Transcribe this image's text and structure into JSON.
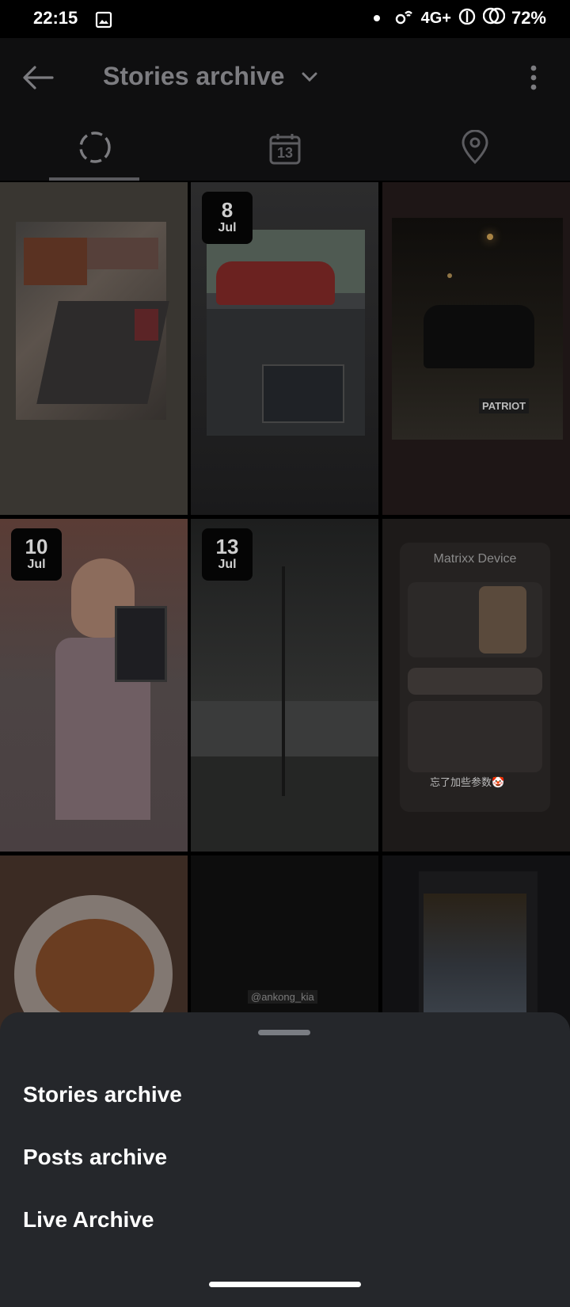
{
  "status_bar": {
    "time": "22:15",
    "network": "4G+",
    "battery": "72%"
  },
  "header": {
    "title": "Stories archive"
  },
  "tabs": [
    {
      "name": "stories",
      "icon": "circle-dashed-icon",
      "active": true
    },
    {
      "name": "calendar",
      "icon": "calendar-icon",
      "calendar_day": "13"
    },
    {
      "name": "map",
      "icon": "location-pin-icon"
    }
  ],
  "grid": {
    "tiles": [
      {
        "id": "hotpot",
        "badge": null
      },
      {
        "id": "car",
        "badge": {
          "day": "8",
          "month": "Jul"
        }
      },
      {
        "id": "night-car",
        "badge": null,
        "caption": "PATRIOT"
      },
      {
        "id": "person",
        "badge": {
          "day": "10",
          "month": "Jul"
        }
      },
      {
        "id": "hall",
        "badge": {
          "day": "13",
          "month": "Jul"
        }
      },
      {
        "id": "matrixx",
        "badge": null,
        "title": "Matrixx Device",
        "caption": "忘了加些参数🤡"
      },
      {
        "id": "noodles",
        "badge": null
      },
      {
        "id": "dark",
        "badge": null,
        "caption": "@ankong_kia"
      },
      {
        "id": "screenshot",
        "badge": null
      }
    ]
  },
  "sheet": {
    "items": [
      "Stories archive",
      "Posts archive",
      "Live Archive"
    ]
  }
}
